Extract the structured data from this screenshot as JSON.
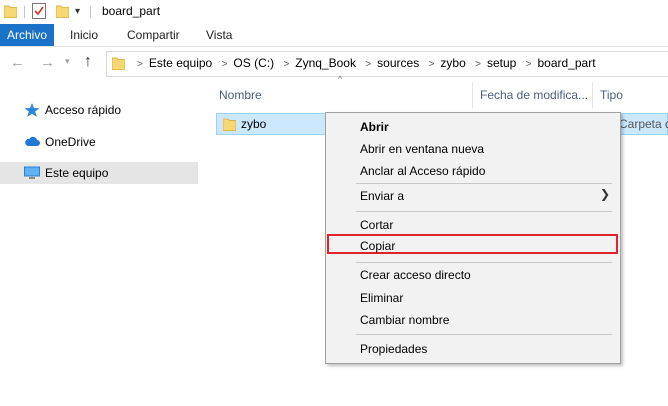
{
  "window": {
    "title": "board_part"
  },
  "quick_access": {
    "folder_icon": "folder-icon",
    "properties_icon": "properties-icon",
    "new_folder_icon": "new-folder-icon",
    "customize": "▾"
  },
  "ribbon": {
    "tabs": [
      {
        "label": "Archivo",
        "active": true
      },
      {
        "label": "Inicio"
      },
      {
        "label": "Compartir"
      },
      {
        "label": "Vista"
      }
    ]
  },
  "address": {
    "breadcrumb": [
      "Este equipo",
      "OS (C:)",
      "Zynq_Book",
      "sources",
      "zybo",
      "setup",
      "board_part"
    ]
  },
  "nav_pane": {
    "items": [
      {
        "label": "Acceso rápido",
        "icon": "star-icon"
      },
      {
        "label": "OneDrive",
        "icon": "cloud-icon"
      },
      {
        "label": "Este equipo",
        "icon": "computer-icon",
        "selected": true
      }
    ]
  },
  "columns": {
    "name": "Nombre",
    "date": "Fecha de modifica...",
    "type": "Tipo"
  },
  "files": [
    {
      "name": "zybo",
      "type": "Carpeta de ar"
    }
  ],
  "context_menu": {
    "items": [
      {
        "label": "Abrir",
        "bold": true
      },
      {
        "label": "Abrir en ventana nueva"
      },
      {
        "label": "Anclar al Acceso rápido"
      },
      {
        "label": "Enviar a",
        "submenu": true
      },
      {
        "label": "Cortar"
      },
      {
        "label": "Copiar",
        "highlighted": true
      },
      {
        "label": "Crear acceso directo"
      },
      {
        "label": "Eliminar"
      },
      {
        "label": "Cambiar nombre"
      },
      {
        "label": "Propiedades"
      }
    ],
    "highlight_color": "#e0242c"
  },
  "colors": {
    "file_tab": "#1a73c8",
    "selection": "#cce8ff",
    "folder": "#f8d775"
  }
}
